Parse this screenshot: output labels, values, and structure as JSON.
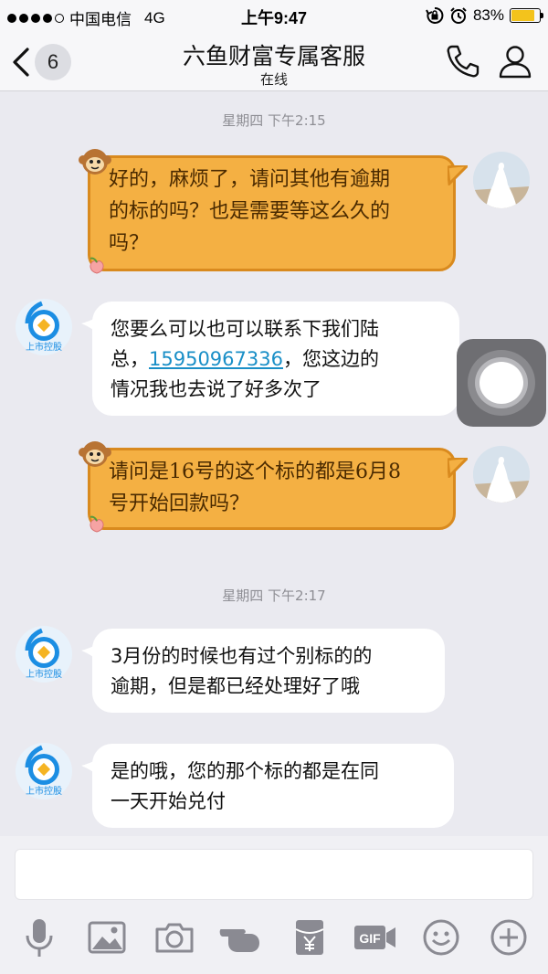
{
  "status_bar": {
    "carrier": "中国电信",
    "network": "4G",
    "time": "上午9:47",
    "battery": "83%",
    "battery_level": 0.83
  },
  "header": {
    "unread_count": "6",
    "title": "六鱼财富专属客服",
    "subtitle": "在线"
  },
  "messages": [
    {
      "type": "timestamp",
      "text": "星期四 下午2:15"
    },
    {
      "type": "outgoing",
      "line1": "好的，麻烦了，请问其他有逾期",
      "line2": "的标的吗？也是需要等这么久的",
      "line3": "吗？"
    },
    {
      "type": "incoming",
      "line1": "您要么可以也可以联系下我们陆",
      "line2_prefix": "总，",
      "phone": "15950967336",
      "line2_suffix": "，您这边的",
      "line3": "情况我也去说了好多次了",
      "avatar_caption": "上市控股"
    },
    {
      "type": "outgoing",
      "line1": "请问是16号的这个标的都是6月8",
      "line2": "号开始回款吗？"
    },
    {
      "type": "timestamp",
      "text": "星期四 下午2:17"
    },
    {
      "type": "incoming",
      "line1": "3月份的时候也有过个别标的的",
      "line2": "逾期，但是都已经处理好了哦",
      "avatar_caption": "上市控股"
    },
    {
      "type": "incoming",
      "line1": "是的哦，您的那个标的都是在同",
      "line2": "一天开始兑付",
      "avatar_caption": "上市控股"
    }
  ],
  "input": {
    "placeholder": ""
  },
  "toolbar_icons": [
    "microphone-icon",
    "image-icon",
    "camera-icon",
    "poke-hand-icon",
    "red-packet-icon",
    "gif-icon",
    "emoji-icon",
    "plus-icon"
  ],
  "colors": {
    "outgoing_bubble": "#f4b043",
    "outgoing_border": "#d98a1e",
    "incoming_bubble": "#ffffff",
    "link": "#1a8fc7",
    "brand_blue": "#1c8ee3"
  }
}
